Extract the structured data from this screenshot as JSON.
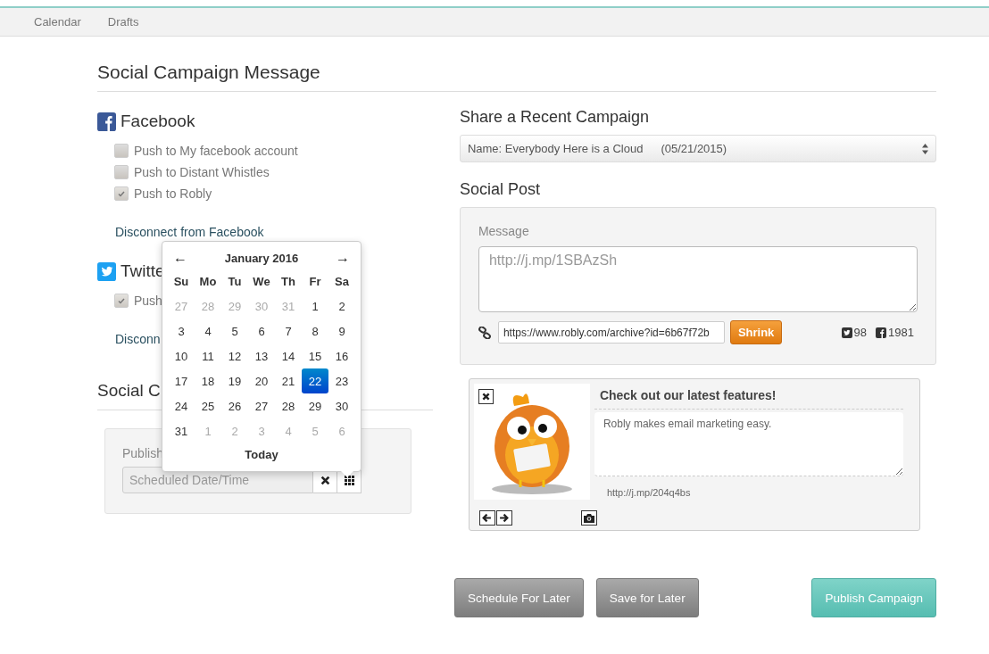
{
  "nav": [
    {
      "label": "Calendar"
    },
    {
      "label": "Drafts"
    }
  ],
  "title": "Social Campaign Message",
  "networks": [
    {
      "kind": "facebook",
      "title": "Facebook",
      "options": [
        {
          "label": "Push to My facebook account",
          "checked": false
        },
        {
          "label": "Push to Distant Whistles",
          "checked": false
        },
        {
          "label": "Push to Robly",
          "checked": true
        }
      ],
      "disconnect": "Disconnect from Facebook"
    },
    {
      "kind": "twitter",
      "title": "Twitte",
      "options": [
        {
          "label": "Push",
          "checked": true
        }
      ],
      "disconnect": "Disconn"
    }
  ],
  "schedule": {
    "title": "Social C",
    "label": "Publish",
    "placeholder": "Scheduled Date/Time"
  },
  "datepicker": {
    "prev": "←",
    "next": "→",
    "month": "January 2016",
    "weekdays": [
      "Su",
      "Mo",
      "Tu",
      "We",
      "Th",
      "Fr",
      "Sa"
    ],
    "weeks": [
      [
        {
          "d": "27",
          "other": true,
          "selected": false
        },
        {
          "d": "28",
          "other": true,
          "selected": false
        },
        {
          "d": "29",
          "other": true,
          "selected": false
        },
        {
          "d": "30",
          "other": true,
          "selected": false
        },
        {
          "d": "31",
          "other": true,
          "selected": false
        },
        {
          "d": "1",
          "other": false,
          "selected": false
        },
        {
          "d": "2",
          "other": false,
          "selected": false
        }
      ],
      [
        {
          "d": "3",
          "other": false,
          "selected": false
        },
        {
          "d": "4",
          "other": false,
          "selected": false
        },
        {
          "d": "5",
          "other": false,
          "selected": false
        },
        {
          "d": "6",
          "other": false,
          "selected": false
        },
        {
          "d": "7",
          "other": false,
          "selected": false
        },
        {
          "d": "8",
          "other": false,
          "selected": false
        },
        {
          "d": "9",
          "other": false,
          "selected": false
        }
      ],
      [
        {
          "d": "10",
          "other": false,
          "selected": false
        },
        {
          "d": "11",
          "other": false,
          "selected": false
        },
        {
          "d": "12",
          "other": false,
          "selected": false
        },
        {
          "d": "13",
          "other": false,
          "selected": false
        },
        {
          "d": "14",
          "other": false,
          "selected": false
        },
        {
          "d": "15",
          "other": false,
          "selected": false
        },
        {
          "d": "16",
          "other": false,
          "selected": false
        }
      ],
      [
        {
          "d": "17",
          "other": false,
          "selected": false
        },
        {
          "d": "18",
          "other": false,
          "selected": false
        },
        {
          "d": "19",
          "other": false,
          "selected": false
        },
        {
          "d": "20",
          "other": false,
          "selected": false
        },
        {
          "d": "21",
          "other": false,
          "selected": false
        },
        {
          "d": "22",
          "other": false,
          "selected": true
        },
        {
          "d": "23",
          "other": false,
          "selected": false
        }
      ],
      [
        {
          "d": "24",
          "other": false,
          "selected": false
        },
        {
          "d": "25",
          "other": false,
          "selected": false
        },
        {
          "d": "26",
          "other": false,
          "selected": false
        },
        {
          "d": "27",
          "other": false,
          "selected": false
        },
        {
          "d": "28",
          "other": false,
          "selected": false
        },
        {
          "d": "29",
          "other": false,
          "selected": false
        },
        {
          "d": "30",
          "other": false,
          "selected": false
        }
      ],
      [
        {
          "d": "31",
          "other": false,
          "selected": false
        },
        {
          "d": "1",
          "other": true,
          "selected": false
        },
        {
          "d": "2",
          "other": true,
          "selected": false
        },
        {
          "d": "3",
          "other": true,
          "selected": false
        },
        {
          "d": "4",
          "other": true,
          "selected": false
        },
        {
          "d": "5",
          "other": true,
          "selected": false
        },
        {
          "d": "6",
          "other": true,
          "selected": false
        }
      ]
    ],
    "today": "Today"
  },
  "share": {
    "title": "Share a Recent Campaign",
    "name": "Name: Everybody Here is a Cloud",
    "date": "(05/21/2015)"
  },
  "post": {
    "title": "Social Post",
    "label": "Message",
    "message": "http://j.mp/1SBAzSh",
    "url": "https://www.robly.com/archive?id=6b67f72b",
    "shrink": "Shrink",
    "twitter_count": "98",
    "facebook_count": "1981"
  },
  "preview": {
    "headline": "Check out our latest features!",
    "description": "Robly makes email marketing easy.",
    "link": "http://j.mp/204q4bs"
  },
  "buttons": [
    {
      "kind": "dark",
      "label": "Schedule For Later"
    },
    {
      "kind": "dark",
      "label": "Save for Later"
    },
    {
      "kind": "primary",
      "label": "Publish Campaign"
    }
  ]
}
